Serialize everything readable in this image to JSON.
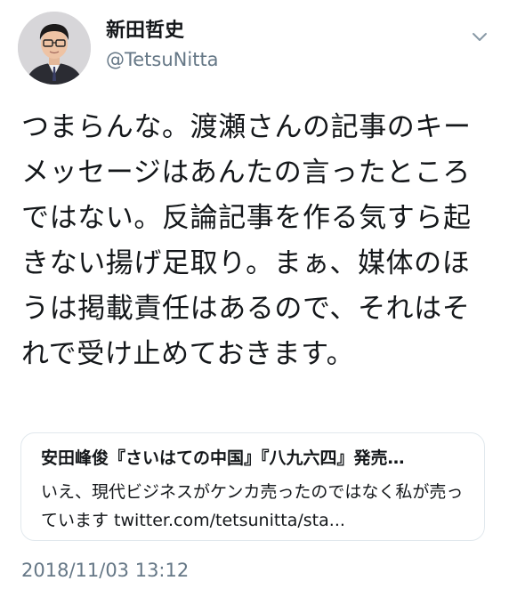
{
  "author": {
    "display_name": "新田哲史",
    "handle": "@TetsuNitta",
    "avatar_icon": "profile-photo-man-glasses"
  },
  "menu_icon": "chevron-down-icon",
  "tweet": {
    "text": "つまらんな。渡瀬さんの記事のキーメッセージはあんたの言ったところではない。反論記事を作る気すら起きない揚げ足取り。まぁ、媒体のほうは掲載責任はあるので、それはそれで受け止めておきます。"
  },
  "quoted_card": {
    "title": "安田峰俊『さいはての中国』『八九六四』発売…",
    "description": "いえ、現代ビジネスがケンカ売ったのではなく私が売っています ",
    "link": "twitter.com/tetsunitta/sta..."
  },
  "timestamp": "2018/11/03 13:12",
  "colors": {
    "primary_text": "#14171a",
    "secondary_text": "#657786",
    "card_border": "#e1e8ed"
  }
}
